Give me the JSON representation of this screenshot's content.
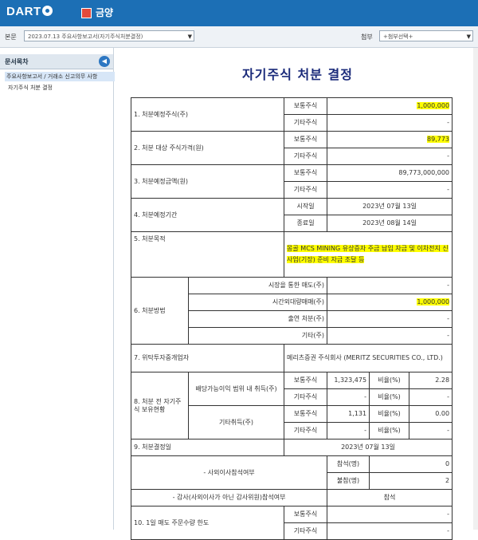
{
  "header": {
    "logo": "DART",
    "company": "금양"
  },
  "subbar": {
    "report_label": "본문",
    "report_select": "2023.07.13 주요사항보고서(자기주식처분결정)",
    "attach_label": "첨부",
    "attach_select": "+첨부선택+"
  },
  "sidebar": {
    "title": "문서목차",
    "items": [
      "주요사항보고서 / 거래소 신고의무 사항",
      "자기주식 처분 결정"
    ]
  },
  "document": {
    "title": "자기주식 처분 결정",
    "rows": {
      "r1_label": "1. 처분예정주식(주)",
      "common_stock": "보통주식",
      "other_stock": "기타주식",
      "r1_common": "1,000,000",
      "r1_other": "-",
      "r2_label": "2. 처분 대상 주식가격(원)",
      "r2_common": "89,773",
      "r2_other": "-",
      "r3_label": "3. 처분예정금액(원)",
      "r3_common": "89,773,000,000",
      "r3_other": "-",
      "r4_label": "4. 처분예정기간",
      "start_label": "시작일",
      "end_label": "종료일",
      "r4_start": "2023년 07월 13일",
      "r4_end": "2023년 08월 14일",
      "r5_label": "5. 처분목적",
      "r5_value": "몽골 MCS MINING 유상증자 주금 납입 자금 및 이차전지 신사업(기장) 준비 자금 조달 등",
      "r6_label": "6. 처분방법",
      "m_market": "시장을 통한 매도(주)",
      "m_market_val": "-",
      "m_block": "시간외대량매매(주)",
      "m_block_val": "1,000,000",
      "m_contrib": "출연 처분(주)",
      "m_contrib_val": "-",
      "m_other": "기타(주)",
      "m_other_val": "-",
      "r7_label": "7. 위탁투자중개업자",
      "r7_value": "메리츠증권 주식회사 (MERITZ SECURITIES CO., LTD.)",
      "r8_label": "8. 처분 전 자기주식 보유현황",
      "dist_label": "배당가능이익 범위 내 취득(주)",
      "other_acq_label": "기타취득(주)",
      "ratio_label": "비율(%)",
      "r8_d_common": "1,323,475",
      "r8_d_common_ratio": "2.28",
      "r8_d_other": "-",
      "r8_d_other_ratio": "-",
      "r8_o_common": "1,131",
      "r8_o_common_ratio": "0.00",
      "r8_o_other": "-",
      "r8_o_other_ratio": "-",
      "r9_label": "9. 처분결정일",
      "r9_value": "2023년 07월 13일",
      "r9a_label": "- 사외이사참석여부",
      "attend_label": "참석(명)",
      "attend_val": "0",
      "absent_label": "불참(명)",
      "absent_val": "2",
      "r9b_label": "- 감사(사외이사가 아닌 감사위원)참석여부",
      "r9b_val": "참석",
      "r10_label": "10. 1일 매도 주문수량 한도",
      "r10_common": "-",
      "r10_other": "-"
    }
  }
}
